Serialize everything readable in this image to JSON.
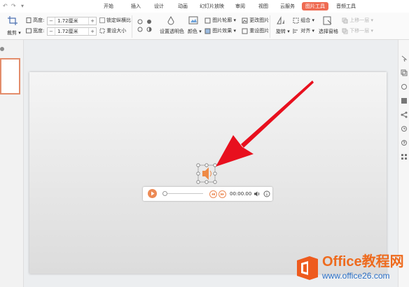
{
  "menu": {
    "items": [
      "开始",
      "插入",
      "设计",
      "动画",
      "幻灯片放映",
      "审阅",
      "视图",
      "云服务",
      "图片工具",
      "音频工具"
    ],
    "active": "图片工具"
  },
  "ribbon": {
    "crop": "裁剪",
    "height_label": "高度:",
    "height_value": "1.72厘米",
    "width_label": "宽度:",
    "width_value": "1.72厘米",
    "lock_ratio": "锁定纵横比",
    "reset_size": "重设大小",
    "set_transparent": "设置透明色",
    "color": "颜色",
    "picture_outline": "图片轮廓",
    "picture_effect": "图片效果",
    "change_picture": "更改图片",
    "reset_picture": "重设图片",
    "rotate": "旋转",
    "group": "组合",
    "align": "对齐",
    "selection_pane": "选择窗格",
    "bring_forward": "上移一层",
    "send_backward": "下移一层"
  },
  "audio": {
    "time": "00:00.00"
  },
  "watermark": {
    "brand": "Office教程网",
    "url": "www.office26.com"
  },
  "colors": {
    "accent": "#ef6b52",
    "audio_orange": "#ec8a55",
    "arrow_red": "#e8101e"
  }
}
